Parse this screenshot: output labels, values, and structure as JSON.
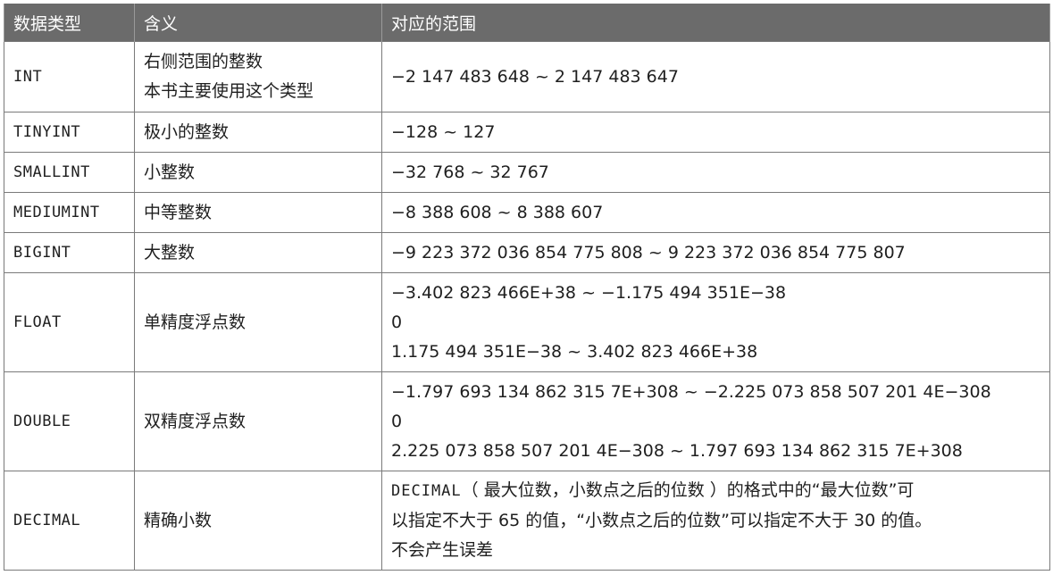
{
  "headers": [
    "数据类型",
    "含义",
    "对应的范围"
  ],
  "rows": {
    "int": {
      "type": "INT",
      "meaning": [
        "右侧范围的整数",
        "本书主要使用这个类型"
      ],
      "range": [
        "−2 147 483 648 ~ 2 147 483 647"
      ]
    },
    "tinyint": {
      "type": "TINYINT",
      "meaning": [
        "极小的整数"
      ],
      "range": [
        "−128 ~ 127"
      ]
    },
    "smallint": {
      "type": "SMALLINT",
      "meaning": [
        "小整数"
      ],
      "range": [
        "−32 768 ~ 32 767"
      ]
    },
    "mediumint": {
      "type": "MEDIUMINT",
      "meaning": [
        "中等整数"
      ],
      "range": [
        "−8 388 608 ~ 8 388 607"
      ]
    },
    "bigint": {
      "type": "BIGINT",
      "meaning": [
        "大整数"
      ],
      "range": [
        "−9 223 372 036 854 775 808 ~ 9 223 372 036 854 775 807"
      ]
    },
    "float": {
      "type": "FLOAT",
      "meaning": [
        "单精度浮点数"
      ],
      "range": [
        "−3.402 823 466E+38 ~ −1.175 494 351E−38",
        "0",
        "1.175 494 351E−38 ~ 3.402 823 466E+38"
      ]
    },
    "double": {
      "type": "DOUBLE",
      "meaning": [
        "双精度浮点数"
      ],
      "range": [
        "−1.797 693 134 862 315 7E+308 ~ −2.225 073 858 507 201 4E−308",
        "0",
        "2.225 073 858 507 201 4E−308 ~ 1.797 693 134 862 315 7E+308"
      ]
    },
    "decimal": {
      "type": "DECIMAL",
      "meaning": [
        "精确小数"
      ],
      "range_code": "DECIMAL",
      "range": [
        "（ 最大位数，小数点之后的位数 ）的格式中的“最大位数”可",
        "以指定不大于 65 的值，“小数点之后的位数”可以指定不大于 30 的值。",
        "不会产生误差"
      ]
    }
  }
}
